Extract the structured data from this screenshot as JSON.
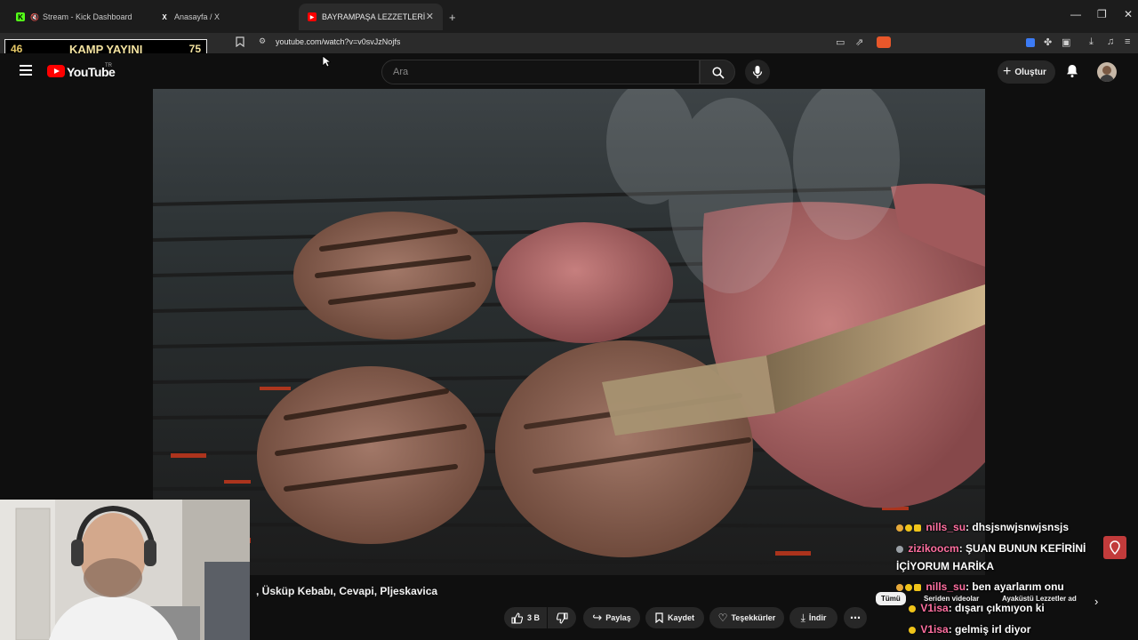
{
  "browser": {
    "tabs": [
      {
        "title": "Stream - Kick Dashboard",
        "favicon": "K",
        "favicon_color": "#53fc18"
      },
      {
        "title": "Anasayfa / X",
        "favicon": "X",
        "favicon_color": "#ffffff"
      },
      {
        "title": "BAYRAMPAŞA LEZZETLERİ | Sim",
        "favicon": "▶",
        "favicon_color": "#ff0000"
      }
    ],
    "new_tab": "+",
    "url": "youtube.com/watch?v=v0svJzNojfs"
  },
  "stream_overlay": {
    "left": "46",
    "title": "KAMP YAYINI",
    "right": "75"
  },
  "youtube": {
    "logo_text": "YouTube",
    "country": "TR",
    "search_placeholder": "Ara",
    "create_label": "Oluştur"
  },
  "video": {
    "title": ", Üsküp Kebabı, Cevapi, Pljeskavica",
    "actions": {
      "likes": "3 B",
      "share": "Paylaş",
      "save": "Kaydet",
      "thanks": "Teşekkürler",
      "download": "İndir"
    }
  },
  "chat": [
    {
      "user": "nills_su",
      "message": ": dhsjsnwjsnwjsnsjs"
    },
    {
      "user": "zizikoocm",
      "message": ": ŞUAN BUNUN KEFİRİNİ"
    },
    {
      "user": "",
      "message": "İÇİYORUM HARİKA"
    },
    {
      "user": "nills_su",
      "message": ": ben ayarlarım onu"
    },
    {
      "user": "V1isa",
      "message": ": dışarı çıkmıyon ki"
    },
    {
      "user": "V1isa",
      "message": ": gelmiş irl diyor"
    }
  ],
  "chips": [
    "Tümü",
    "Seriden videolar",
    "Ayaküstü Lezzetler ad"
  ],
  "colors": {
    "accent": "#ff0000",
    "chat_user": "#ff6fa0",
    "overlay_text": "#f4e3a0"
  }
}
